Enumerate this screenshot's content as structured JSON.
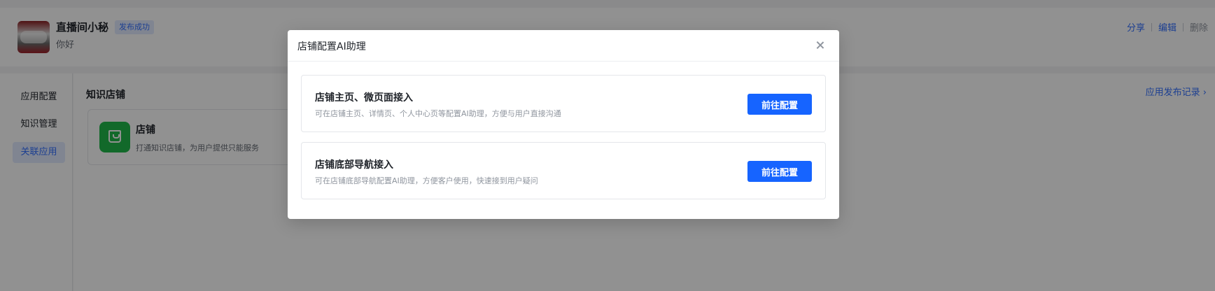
{
  "app": {
    "name": "直播间小秘",
    "status": "发布成功",
    "description": "你好",
    "actions": {
      "share": "分享",
      "edit": "编辑",
      "delete": "删除"
    }
  },
  "sidebar": {
    "items": [
      {
        "label": "应用配置"
      },
      {
        "label": "知识管理"
      },
      {
        "label": "关联应用"
      }
    ],
    "active_index": 2
  },
  "content": {
    "title": "知识店铺",
    "publish_record_link": "应用发布记录",
    "shop_card": {
      "name": "店铺",
      "description": "打通知识店铺，为用户提供只能服务"
    }
  },
  "modal": {
    "title": "店铺配置AI助理",
    "options": [
      {
        "title": "店铺主页、微页面接入",
        "description": "可在店铺主页、详情页、个人中心页等配置AI助理，方便与用户直接沟通",
        "button": "前往配置"
      },
      {
        "title": "店铺底部导航接入",
        "description": "可在店铺底部导航配置AI助理，方便客户使用，快速接到用户疑问",
        "button": "前往配置"
      }
    ]
  },
  "colors": {
    "accent": "#1664ff",
    "link": "#3370ff",
    "success_badge_bg": "#e1eaff",
    "shop_icon": "#21b94a",
    "overlay": "rgba(0,0,0,0.43)"
  }
}
